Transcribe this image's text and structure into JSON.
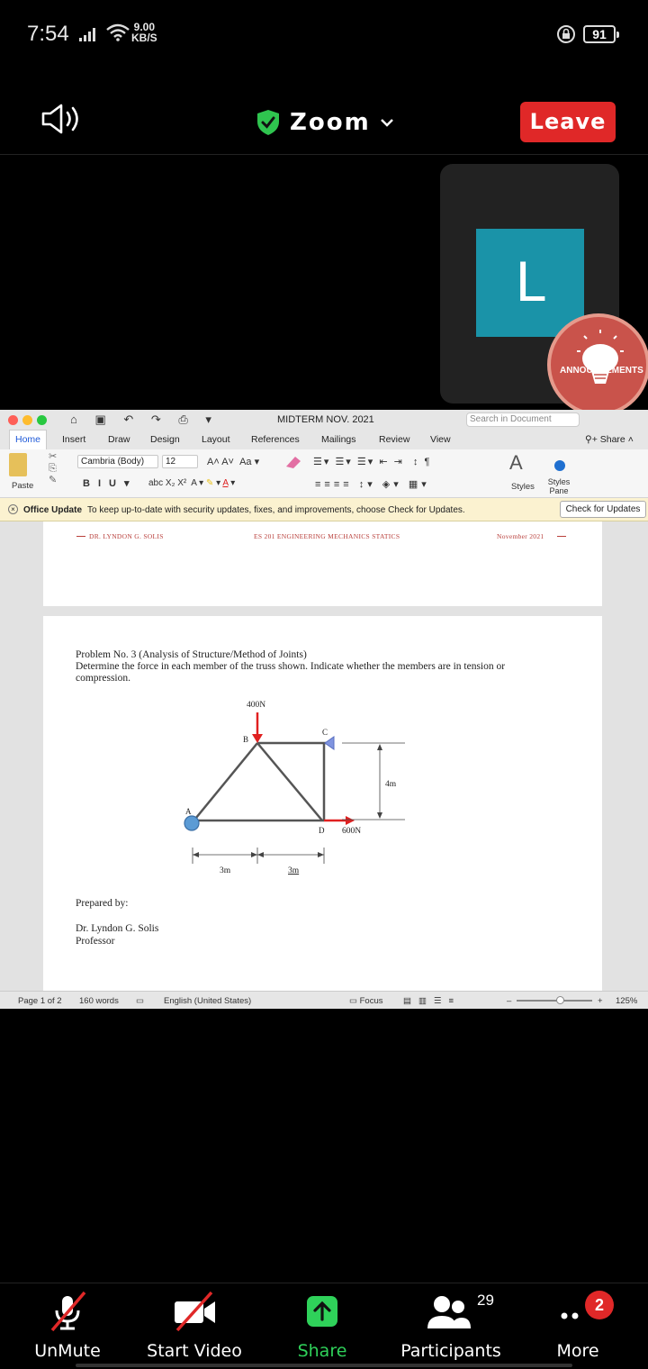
{
  "status_bar": {
    "time": "7:54",
    "speed_value": "9.00",
    "speed_unit": "KB/S",
    "battery": "91"
  },
  "zoom": {
    "title": "Zoom",
    "leave_label": "Leave",
    "leave_color": "#e02828",
    "participant_initial": "L",
    "avatar_color": "#1a93a8",
    "badge_text": "ANNOUNCEMENTS"
  },
  "word": {
    "doc_title": "MIDTERM NOV. 2021",
    "search_placeholder": "Search in Document",
    "tabs": [
      "Home",
      "Insert",
      "Draw",
      "Design",
      "Layout",
      "References",
      "Mailings",
      "Review",
      "View"
    ],
    "share_label": "Share",
    "font_name": "Cambria (Body)",
    "font_size": "12",
    "paste_label": "Paste",
    "styles_label": "Styles",
    "styles_pane_label": "Styles Pane",
    "update_title": "Office Update",
    "update_message": "To keep up-to-date with security updates, fixes, and improvements, choose Check for Updates.",
    "update_button": "Check for Updates",
    "header_left": "DR. LYNDON G. SOLIS",
    "header_center": "ES 201 ENGINEERING MECHANICS STATICS",
    "header_right": "November 2021",
    "problem_title": "Problem No. 3 (Analysis of Structure/Method of Joints)",
    "problem_line1": "Determine the force in each member of the truss shown. Indicate whether the members are in tension or",
    "problem_line2": "compression.",
    "diagram": {
      "load_b": "400N",
      "load_d": "600N",
      "height": "4m",
      "span_1": "3m",
      "span_2": "3m",
      "node_a": "A",
      "node_b": "B",
      "node_c": "C",
      "node_d": "D"
    },
    "prepared_by": "Prepared by:",
    "author": "Dr. Lyndon G. Solis",
    "author_title": "Professor",
    "status": {
      "page": "Page 1 of 2",
      "words": "160 words",
      "language": "English (United States)",
      "focus": "Focus",
      "zoom": "125%"
    }
  },
  "toolbar": {
    "unmute": "UnMute",
    "start_video": "Start Video",
    "share": "Share",
    "participants": "Participants",
    "participants_count": "29",
    "more": "More",
    "more_badge": "2"
  }
}
